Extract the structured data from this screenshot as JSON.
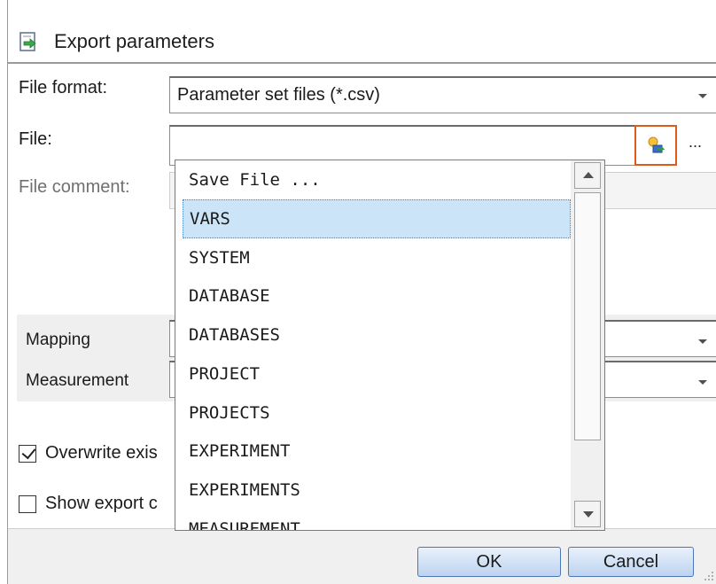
{
  "window": {
    "title": "Export parameters",
    "icon": "export-arrow-icon"
  },
  "form": {
    "file_format_label": "File format:",
    "file_format_value": "Parameter set files (*.csv)",
    "file_label": "File:",
    "file_value": "",
    "file_browse_label": "...",
    "file_comment_label": "File comment:"
  },
  "group": {
    "mapping_label": "Mapping",
    "measurement_label": "Measurement"
  },
  "options": {
    "overwrite_label": "Overwrite exis",
    "overwrite_checked": true,
    "show_export_label": "Show export c",
    "show_export_checked": false
  },
  "buttons": {
    "ok": "OK",
    "cancel": "Cancel"
  },
  "dropdown": {
    "items": [
      "Save File ...",
      "VARS",
      "SYSTEM",
      "DATABASE",
      "DATABASES",
      "PROJECT",
      "PROJECTS",
      "EXPERIMENT",
      "EXPERIMENTS",
      "MEASUREMENT"
    ],
    "selected": "VARS"
  },
  "colors": {
    "highlight": "#e05a1a",
    "selection": "#cce4f7",
    "button": "#bdd3f0"
  }
}
